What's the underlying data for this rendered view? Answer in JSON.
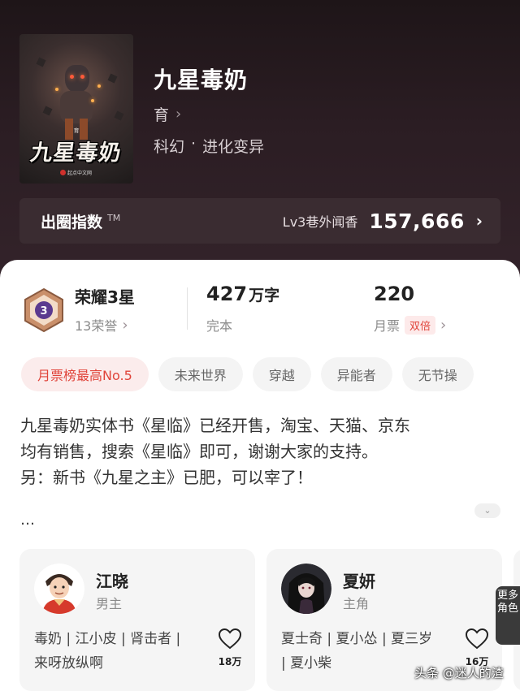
{
  "book": {
    "title": "九星毒奶",
    "author": "育",
    "genre": "科幻",
    "separator": "·",
    "subgenre": "进化变异",
    "cover": {
      "title": "九星毒奶",
      "author": "育",
      "publisher": "起点中文网"
    }
  },
  "index": {
    "label": "出圈指数",
    "tm": "TM",
    "level": "Lv3巷外闻香",
    "value": "157,666"
  },
  "stats": {
    "honor_level": "3",
    "honor_title": "荣耀3星",
    "honor_count": "13荣誉",
    "word_count": "427",
    "word_unit": "万字",
    "status": "完本",
    "monthly_tickets": "220",
    "tickets_label": "月票",
    "double_badge": "双倍"
  },
  "tags": [
    "月票榜最高No.5",
    "未来世界",
    "穿越",
    "异能者",
    "无节操"
  ],
  "intro": {
    "lines": [
      "九星毒奶实体书《星临》已经开售，淘宝、天猫、京东",
      "均有销售，搜索《星临》即可，谢谢大家的支持。",
      "另：新书《九星之主》已肥，可以宰了！"
    ],
    "ellipsis": "…"
  },
  "characters": [
    {
      "name": "江晓",
      "role": "男主",
      "tag_line1": "毒奶 | 江小皮 | 肾击者 |",
      "tag_line2": "来呀放纵啊",
      "likes": "18万"
    },
    {
      "name": "夏妍",
      "role": "主角",
      "tag_line1": "夏士奇 | 夏小怂 | 夏三岁",
      "tag_line2": "| 夏小柴",
      "likes": "16万"
    }
  ],
  "more_roles": "更多角色",
  "watermark": "头条 @迷人的渣",
  "colors": {
    "accent_red": "#e0443a",
    "hero_bg": "#2b1d23"
  }
}
